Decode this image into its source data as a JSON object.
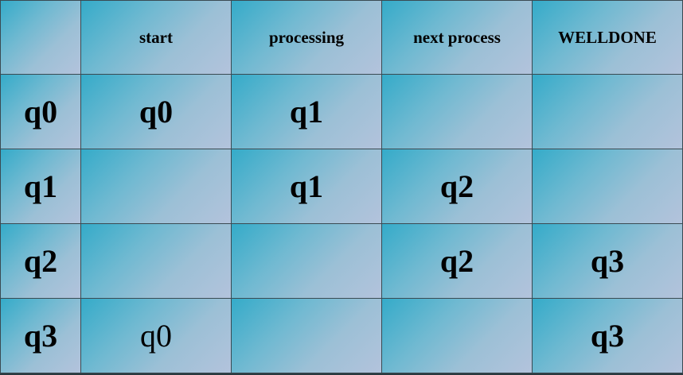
{
  "table": {
    "columns": [
      "",
      "start",
      "processing",
      "next process",
      "WELLDONE"
    ],
    "rows": [
      {
        "state": "q0",
        "cells": [
          "q0",
          "q1",
          "",
          ""
        ]
      },
      {
        "state": "q1",
        "cells": [
          "",
          "q1",
          "q2",
          ""
        ]
      },
      {
        "state": "q2",
        "cells": [
          "",
          "",
          "q2",
          "q3"
        ]
      },
      {
        "state": "q3",
        "cells": [
          "q0",
          "",
          "",
          "q3"
        ]
      }
    ],
    "bold_weights": [
      [
        true,
        true,
        true,
        true
      ],
      [
        true,
        true,
        true,
        true
      ],
      [
        true,
        true,
        true,
        true
      ],
      [
        false,
        true,
        true,
        true
      ]
    ]
  }
}
